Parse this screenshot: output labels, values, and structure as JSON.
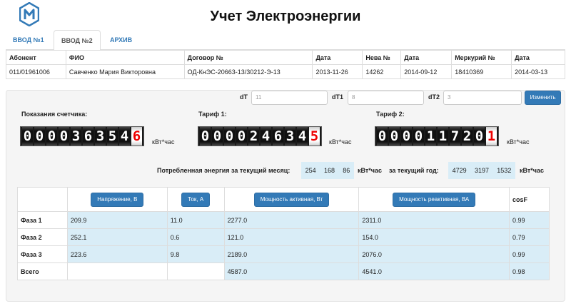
{
  "header": {
    "title": "Учет Электроэнергии",
    "logo_icon": "m-hexagon-logo"
  },
  "tabs": [
    {
      "label": "ВВОД №1",
      "active": false
    },
    {
      "label": "ВВОД №2",
      "active": true
    },
    {
      "label": "АРХИВ",
      "active": false
    }
  ],
  "abonent": {
    "headers": [
      "Абонент",
      "ФИО",
      "Договор №",
      "Дата",
      "Нева №",
      "Дата",
      "Меркурий №",
      "Дата"
    ],
    "row": [
      "011/01961006",
      "Савченко Мария Викторовна",
      "ОД-КнЭС-20663-13/30212-Э-13",
      "2013-11-26",
      "14262",
      "2014-09-12",
      "18410369",
      "2014-03-13"
    ]
  },
  "controls": {
    "dt_label": "dT",
    "dt_value": "11",
    "dt1_label": "dT1",
    "dt1_value": "8",
    "dt2_label": "dT2",
    "dt2_value": "3",
    "button": "Изменить"
  },
  "meters": {
    "readings": {
      "label": "Показания счетчика:",
      "digits": "0000363546",
      "unit": "кВт*час"
    },
    "tariff1": {
      "label": "Тариф 1:",
      "digits": "0000246345",
      "unit": "кВт*час"
    },
    "tariff2": {
      "label": "Тариф 2:",
      "digits": "0000117201",
      "unit": "кВт*час"
    }
  },
  "consumption": {
    "month_label": "Потребленная энергия за текущий месяц:",
    "month_values": [
      "254",
      "168",
      "86"
    ],
    "month_unit": "кВт*час",
    "year_label": "за текущий год:",
    "year_values": [
      "4729",
      "3197",
      "1532"
    ],
    "year_unit": "кВт*час"
  },
  "phases": {
    "headers": [
      "",
      "Напряжение, В",
      "Ток, А",
      "Мощность активная, Вт",
      "Мощность реактивная, ВА",
      "cosF"
    ],
    "rows": [
      [
        "Фаза 1",
        "209.9",
        "11.0",
        "2277.0",
        "2311.0",
        "0.99"
      ],
      [
        "Фаза 2",
        "252.1",
        "0.6",
        "121.0",
        "154.0",
        "0.79"
      ],
      [
        "Фаза 3",
        "223.6",
        "9.8",
        "2189.0",
        "2076.0",
        "0.99"
      ],
      [
        "Всего",
        "",
        "",
        "4587.0",
        "4541.0",
        "0.98"
      ]
    ]
  },
  "colors": {
    "accent": "#337ab7",
    "highlight": "#d9edf7",
    "digit_red": "#e00000"
  }
}
